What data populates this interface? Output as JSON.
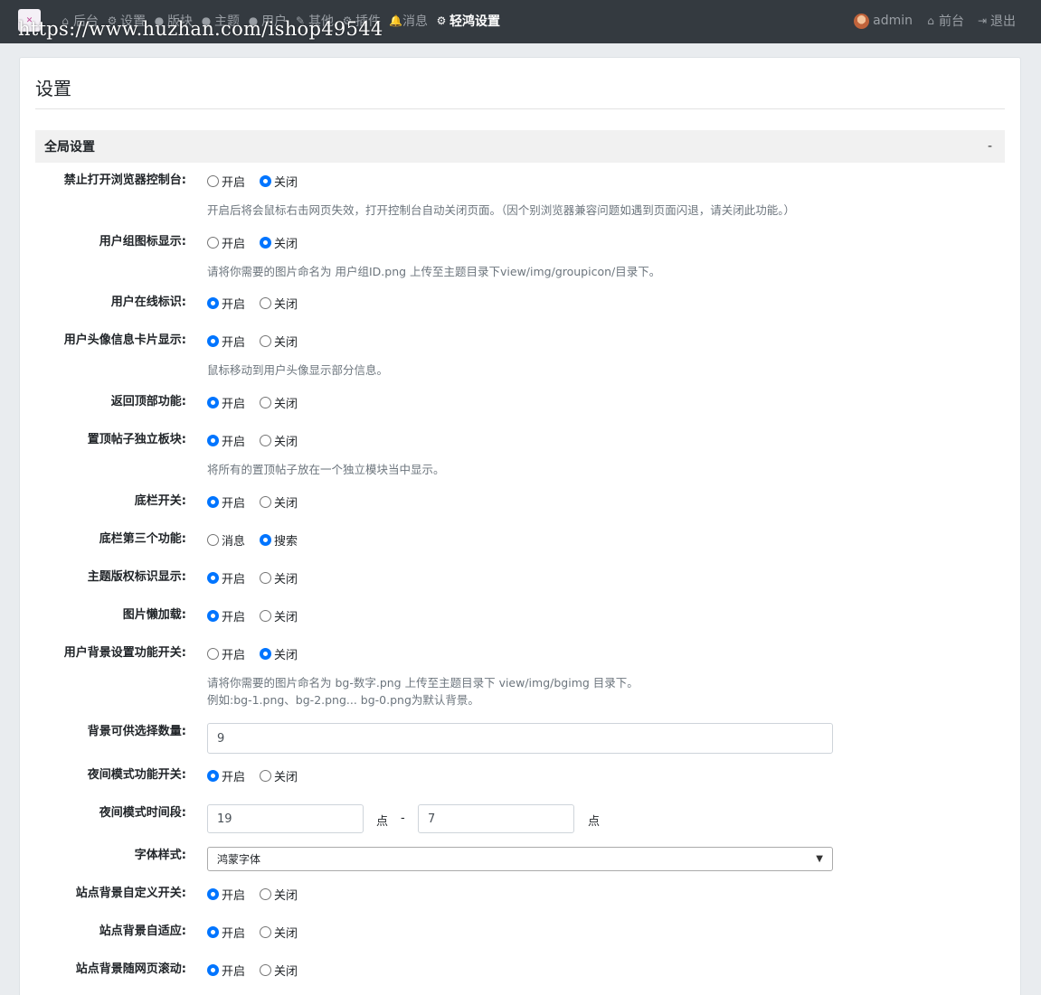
{
  "nav": {
    "items": [
      {
        "label": "后台",
        "icon": "home-icon",
        "glyph": "⌂"
      },
      {
        "label": "设置",
        "icon": "gear-icon",
        "glyph": "⚙"
      },
      {
        "label": "版块",
        "icon": "comment-icon",
        "glyph": "●"
      },
      {
        "label": "主题",
        "icon": "comments-icon",
        "glyph": "●"
      },
      {
        "label": "用户",
        "icon": "user-icon",
        "glyph": "●"
      },
      {
        "label": "其他",
        "icon": "wrench-icon",
        "glyph": "✎"
      },
      {
        "label": "插件",
        "icon": "cogs-icon",
        "glyph": "⚙"
      },
      {
        "label": "消息",
        "icon": "bell-icon",
        "glyph": "🔔"
      },
      {
        "label": "轻鸿设置",
        "icon": "gear-icon",
        "glyph": "⚙"
      }
    ],
    "user": "admin",
    "front": "前台",
    "logout": "退出",
    "home_glyph": "⌂",
    "logout_glyph": "⇥"
  },
  "watermark": "https://www.huzhan.com/ishop49544",
  "page": {
    "title": "设置"
  },
  "section": {
    "title": "全局设置",
    "toggle": "-"
  },
  "fields": {
    "disable_console": {
      "label": "禁止打开浏览器控制台:",
      "options": [
        "开启",
        "关闭"
      ],
      "selected": 1,
      "help": "开启后将会鼠标右击网页失效，打开控制台自动关闭页面。（因个别浏览器兼容问题如遇到页面闪退，请关闭此功能。）"
    },
    "group_icon": {
      "label": "用户组图标显示:",
      "options": [
        "开启",
        "关闭"
      ],
      "selected": 1,
      "help": "请将你需要的图片命名为 用户组ID.png 上传至主题目录下view/img/groupicon/目录下。"
    },
    "online_mark": {
      "label": "用户在线标识:",
      "options": [
        "开启",
        "关闭"
      ],
      "selected": 0
    },
    "avatar_card": {
      "label": "用户头像信息卡片显示:",
      "options": [
        "开启",
        "关闭"
      ],
      "selected": 0,
      "help": "鼠标移动到用户头像显示部分信息。"
    },
    "back_top": {
      "label": "返回顶部功能:",
      "options": [
        "开启",
        "关闭"
      ],
      "selected": 0
    },
    "sticky_block": {
      "label": "置顶帖子独立板块:",
      "options": [
        "开启",
        "关闭"
      ],
      "selected": 0,
      "help": "将所有的置顶帖子放在一个独立模块当中显示。"
    },
    "footer_switch": {
      "label": "底栏开关:",
      "options": [
        "开启",
        "关闭"
      ],
      "selected": 0
    },
    "footer_third": {
      "label": "底栏第三个功能:",
      "options": [
        "消息",
        "搜索"
      ],
      "selected": 1
    },
    "copyright_mark": {
      "label": "主题版权标识显示:",
      "options": [
        "开启",
        "关闭"
      ],
      "selected": 0
    },
    "lazy_load": {
      "label": "图片懒加载:",
      "options": [
        "开启",
        "关闭"
      ],
      "selected": 0
    },
    "user_bg": {
      "label": "用户背景设置功能开关:",
      "options": [
        "开启",
        "关闭"
      ],
      "selected": 1,
      "help": "请将你需要的图片命名为 bg-数字.png 上传至主题目录下 view/img/bgimg 目录下。",
      "help2": "例如:bg-1.png、bg-2.png... bg-0.png为默认背景。"
    },
    "bg_count": {
      "label": "背景可供选择数量:",
      "value": "9"
    },
    "night_mode": {
      "label": "夜间模式功能开关:",
      "options": [
        "开启",
        "关闭"
      ],
      "selected": 0
    },
    "night_period": {
      "label": "夜间模式时间段:",
      "start": "19",
      "end": "7",
      "unit": "点",
      "dash": "-"
    },
    "font_style": {
      "label": "字体样式:",
      "value": "鸿蒙字体"
    },
    "site_bg": {
      "label": "站点背景自定义开关:",
      "options": [
        "开启",
        "关闭"
      ],
      "selected": 0
    },
    "site_bg_fit": {
      "label": "站点背景自适应:",
      "options": [
        "开启",
        "关闭"
      ],
      "selected": 0
    },
    "site_bg_scroll": {
      "label": "站点背景随网页滚动:",
      "options": [
        "开启",
        "关闭"
      ],
      "selected": 0
    }
  },
  "colors": {
    "nav_bg": "#343a40",
    "accent": "#0075ff",
    "page_bg": "#e9ecef"
  }
}
